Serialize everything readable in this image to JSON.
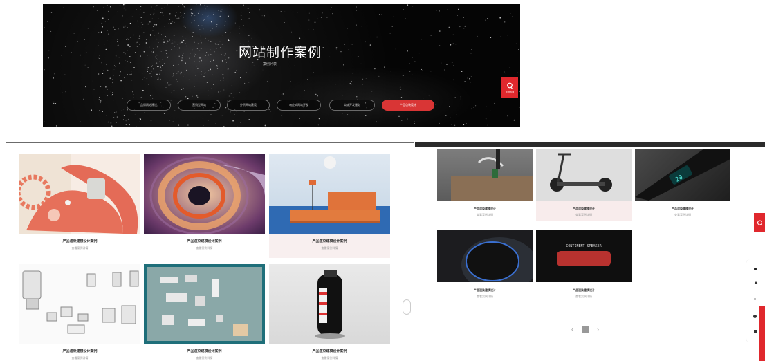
{
  "hero": {
    "title": "网站制作案例",
    "subtitle": "案例列表",
    "filters": [
      "品牌网站建设",
      "营销型网站",
      "外贸网站建设",
      "响应式网站开发",
      "商城开发服务",
      "产品包装设计"
    ],
    "active_filter_index": 5,
    "consult_label": "在线咨询"
  },
  "left_grid": {
    "items": [
      {
        "title": "产品渲染建模设计案例",
        "subtitle": "查看案例详情"
      },
      {
        "title": "产品渲染建模设计案例",
        "subtitle": "查看案例详情"
      },
      {
        "title": "产品渲染建模设计案例",
        "subtitle": "查看案例详情"
      },
      {
        "title": "产品渲染建模设计案例",
        "subtitle": "查看案例详情"
      },
      {
        "title": "产品渲染建模设计案例",
        "subtitle": "查看案例详情"
      },
      {
        "title": "产品渲染建模设计案例",
        "subtitle": "查看案例详情"
      }
    ]
  },
  "right_grid": {
    "items": [
      {
        "title": "产品渲染建模设计",
        "subtitle": "查看案例详情"
      },
      {
        "title": "产品渲染建模设计",
        "subtitle": "查看案例详情"
      },
      {
        "title": "产品渲染建模设计",
        "subtitle": "查看案例详情"
      },
      {
        "title": "产品渲染建模设计",
        "subtitle": "查看案例详情"
      },
      {
        "title": "产品渲染建模设计",
        "subtitle": "查看案例详情"
      }
    ],
    "display_text": "20",
    "speaker_text": "CONTINENT SPEAKER",
    "pagination": {
      "prev": "‹",
      "current": "1",
      "next": "›"
    }
  },
  "colors": {
    "accent": "#e0282d",
    "hero_bg": "#050505"
  }
}
